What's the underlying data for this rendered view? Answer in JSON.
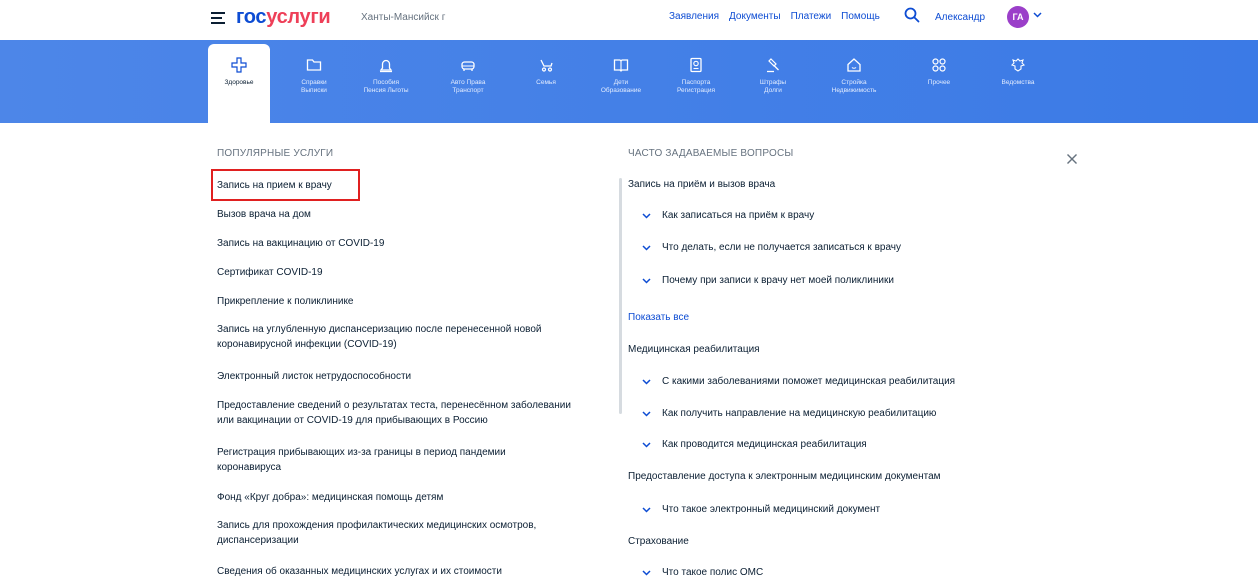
{
  "header": {
    "logo_gos": "гос",
    "logo_uslugi": "услуги",
    "region": "Ханты-Мансийск г",
    "nav": [
      "Заявления",
      "Документы",
      "Платежи",
      "Помощь"
    ],
    "username": "Александр",
    "avatar_initials": "ГА"
  },
  "categories": [
    {
      "line1": "Здоровье",
      "line2": "",
      "icon": "plus-icon"
    },
    {
      "line1": "Справки",
      "line2": "Выписки",
      "icon": "folder-icon"
    },
    {
      "line1": "Пособия",
      "line2": "Пенсия Льготы",
      "icon": "bell-icon"
    },
    {
      "line1": "Авто Права",
      "line2": "Транспорт",
      "icon": "car-icon"
    },
    {
      "line1": "Семья",
      "line2": "",
      "icon": "stroller-icon"
    },
    {
      "line1": "Дети",
      "line2": "Образование",
      "icon": "book-icon"
    },
    {
      "line1": "Паспорта",
      "line2": "Регистрация",
      "icon": "passport-icon"
    },
    {
      "line1": "Штрафы",
      "line2": "Долги",
      "icon": "gavel-icon"
    },
    {
      "line1": "Стройка",
      "line2": "Недвижимость",
      "icon": "house-icon"
    },
    {
      "line1": "Прочее",
      "line2": "",
      "icon": "grid-icon"
    },
    {
      "line1": "Ведомства",
      "line2": "",
      "icon": "emblem-icon"
    }
  ],
  "popular": {
    "title": "ПОПУЛЯРНЫЕ УСЛУГИ",
    "items": [
      {
        "line1": "Запись на прием к врачу",
        "line2": ""
      },
      {
        "line1": "Вызов врача на дом",
        "line2": ""
      },
      {
        "line1": "Запись на вакцинацию от COVID-19",
        "line2": ""
      },
      {
        "line1": "Сертификат COVID-19",
        "line2": ""
      },
      {
        "line1": "Прикрепление к поликлинике",
        "line2": ""
      },
      {
        "line1": "Запись на углубленную диспансеризацию после перенесенной новой",
        "line2": "коронавирусной инфекции (COVID-19)"
      },
      {
        "line1": "Электронный листок нетрудоспособности",
        "line2": ""
      },
      {
        "line1": "Предоставление сведений о результатах теста, перенесённом заболевании",
        "line2": "или вакцинации от COVID-19 для прибывающих в Россию"
      },
      {
        "line1": "Регистрация прибывающих из-за границы в период пандемии",
        "line2": "коронавируса"
      },
      {
        "line1": "Фонд «Круг добра»: медицинская помощь детям",
        "line2": ""
      },
      {
        "line1": "Запись для прохождения профилактических медицинских осмотров,",
        "line2": "диспансеризации"
      },
      {
        "line1": "Сведения об оказанных медицинских услугах и их стоимости",
        "line2": ""
      }
    ]
  },
  "faq": {
    "title": "ЧАСТО ЗАДАВАЕМЫЕ ВОПРОСЫ",
    "show_all": "Показать все",
    "groups": [
      {
        "heading": "Запись на приём и вызов врача",
        "questions": [
          "Как записаться на приём к врачу",
          "Что делать, если не получается записаться к врачу",
          "Почему при записи к врачу нет моей поликлиники"
        ]
      },
      {
        "heading": "Медицинская реабилитация",
        "questions": [
          "С какими заболеваниями поможет медицинская реабилитация",
          "Как получить направление на медицинскую реабилитацию",
          "Как проводится медицинская реабилитация"
        ]
      },
      {
        "heading": "Предоставление доступа к электронным медицинским документам",
        "questions": [
          "Что такое электронный медицинский документ"
        ]
      },
      {
        "heading": "Страхование",
        "questions": [
          "Что такое полис ОМС"
        ]
      }
    ]
  },
  "colors": {
    "brand_blue": "#0d4cd3",
    "brand_red": "#ee3f58",
    "catbar": "#4d86e8",
    "avatar": "#9b3fc9",
    "highlight": "#e02020"
  }
}
